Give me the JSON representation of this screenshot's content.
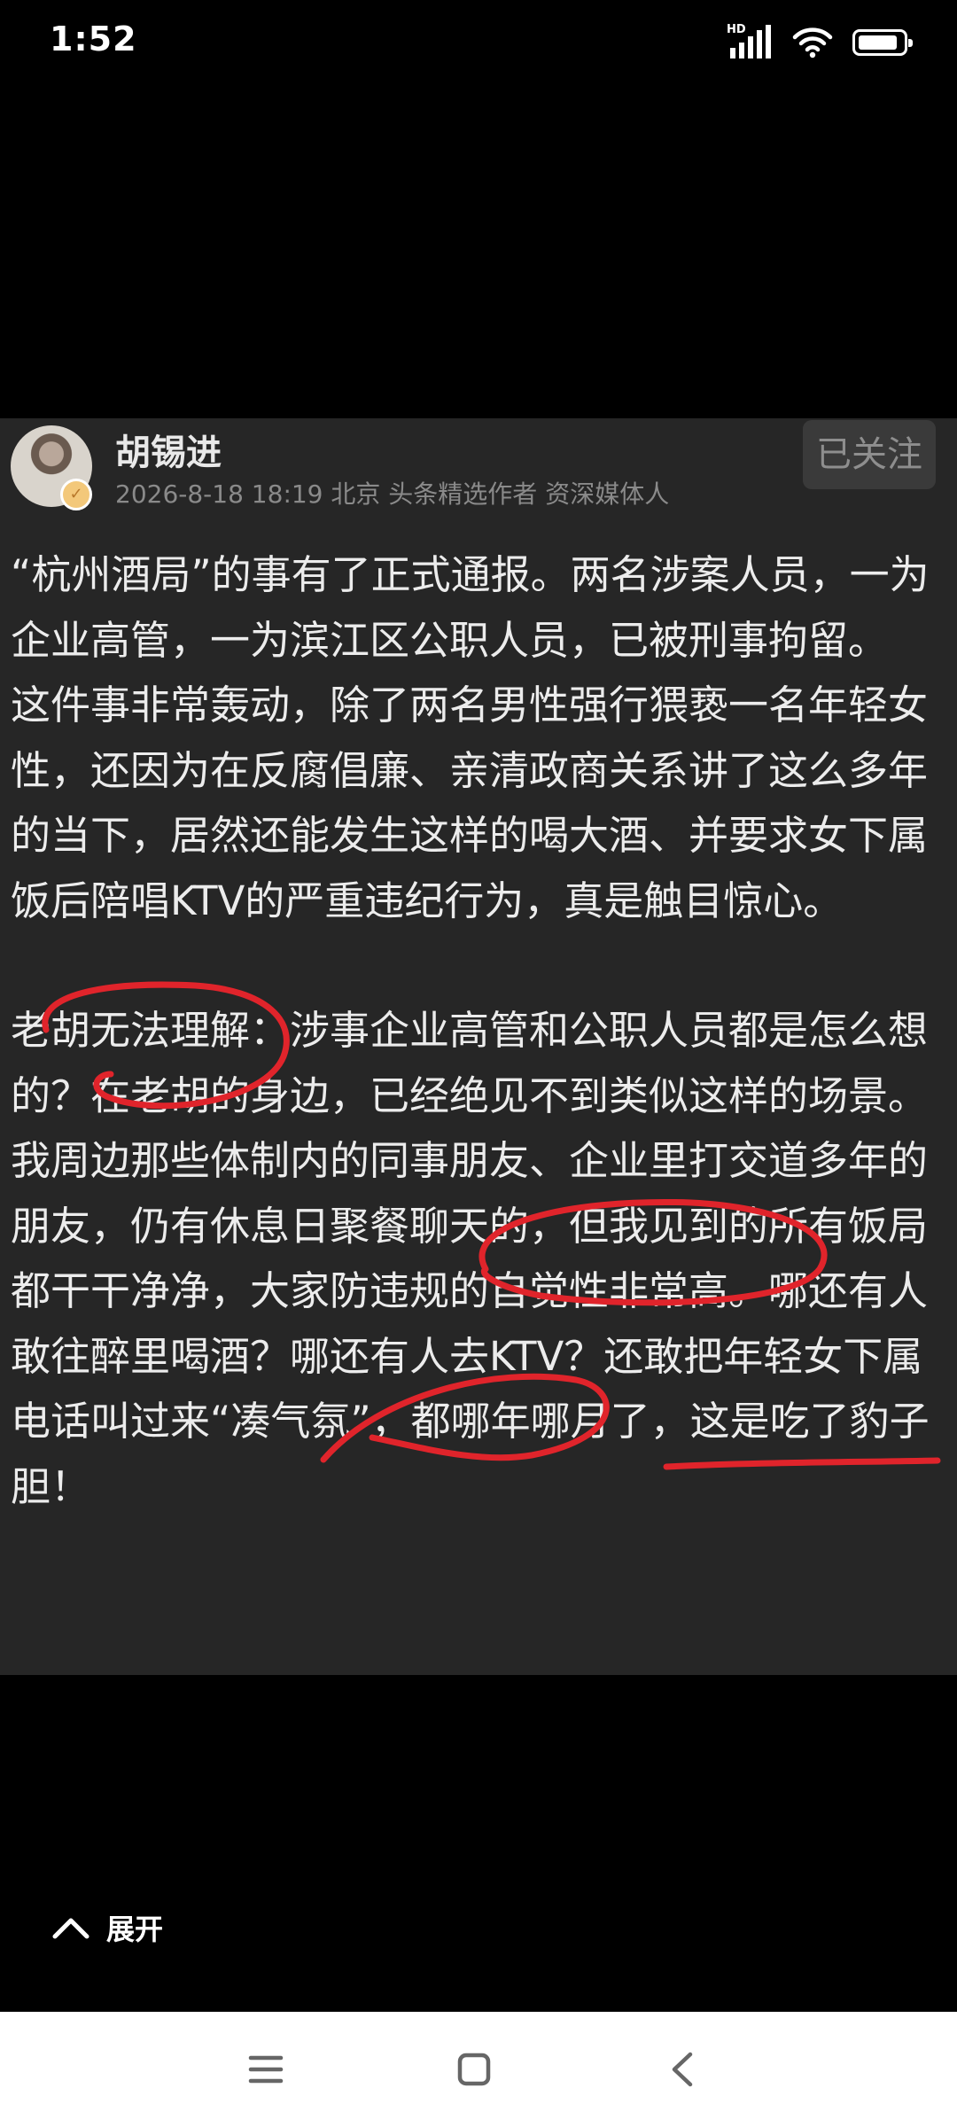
{
  "status_bar": {
    "time": "1:52",
    "hd": "HD",
    "battery_level": 0.85
  },
  "post": {
    "author": "胡锡进",
    "meta": "2026-8-18 18:19 北京 头条精选作者 资深媒体人",
    "follow_label": "已关注",
    "paragraphs": [
      "“杭州酒局”的事有了正式通报。两名涉案人员，一为企业高管，一为滨江区公职人员，已被刑事拘留。",
      "这件事非常轰动，除了两名男性强行猥亵一名年轻女性，还因为在反腐倡廉、亲清政商关系讲了这么多年的当下，居然还能发生这样的喝大酒、并要求女下属饭后陪唱KTV的严重违纪行为，真是触目惊心。",
      "老胡无法理解：涉事企业高管和公职人员都是怎么想的？在老胡的身边，已经绝见不到类似这样的场景。我周边那些体制内的同事朋友、企业里打交道多年的朋友，仍有休息日聚餐聊天的，但我见到的所有饭局都干干净净，大家防违规的自觉性非常高。哪还有人敢往醉里喝酒？哪还有人去KTV？还敢把年轻女下属电话叫过来“凑气氛”，都哪年哪月了，这是吃了豹子胆！"
    ],
    "annotation_color": "#e0242b"
  },
  "footer": {
    "expand_label": "展开"
  },
  "icons": [
    "signal-icon",
    "wifi-icon",
    "battery-icon",
    "avatar-badge-icon",
    "chevron-up-icon",
    "menu-icon",
    "home-icon",
    "back-icon"
  ]
}
